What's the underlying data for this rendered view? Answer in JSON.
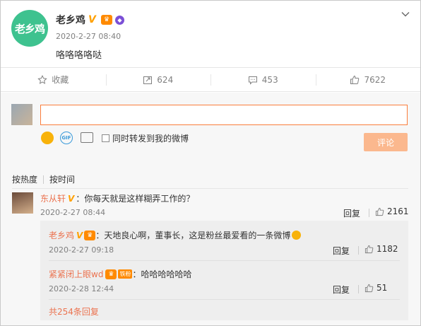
{
  "post": {
    "avatar_text": "老乡鸡",
    "author": "老乡鸡",
    "time": "2020-2-27 08:40",
    "text": "咯咯咯咯哒"
  },
  "actions": {
    "favorite": "收藏",
    "repost_count": "624",
    "comment_count": "453",
    "like_count": "7622"
  },
  "composer": {
    "input_value": "",
    "repost_label": "同时转发到我的微博",
    "submit_label": "评论"
  },
  "sort": {
    "by_heat": "按热度",
    "by_time": "按时间"
  },
  "comment": {
    "user": "东从轩",
    "text": "：你每天就是这样糊弄工作的？",
    "time": "2020-2-27 08:44",
    "reply_label": "回复",
    "likes": "2161"
  },
  "replies": [
    {
      "user": "老乡鸡",
      "text": "：天地良心啊，董事长，这是粉丝最爱看的一条微博",
      "time": "2020-2-27 09:18",
      "reply_label": "回复",
      "likes": "1182"
    },
    {
      "user": "紧紧闭上眼wd",
      "fan_badge": "铁粉",
      "text": "：哈哈哈哈哈哈",
      "time": "2020-2-28 12:44",
      "reply_label": "回复",
      "likes": "51"
    }
  ],
  "more_replies": "共254条回复",
  "colors": {
    "accent": "#eb7350",
    "input_border": "#fa7d3c",
    "submit_bg": "#fbb88e",
    "avatar_bg": "#3ec28f",
    "verified": "#ffa000"
  }
}
